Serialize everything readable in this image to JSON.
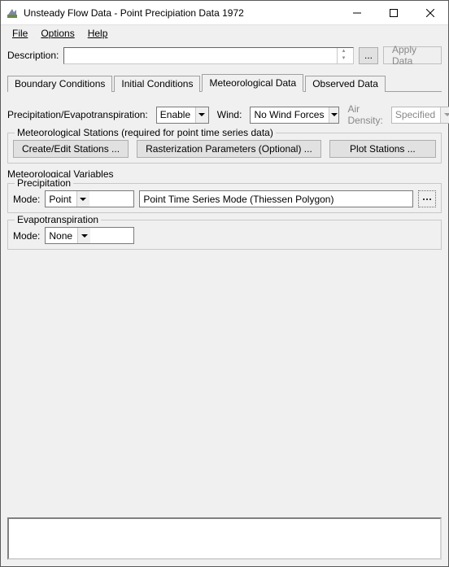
{
  "window": {
    "title": "Unsteady Flow Data - Point Precipiation Data 1972"
  },
  "menubar": {
    "file": "File",
    "options": "Options",
    "help": "Help"
  },
  "description": {
    "label": "Description:",
    "value": ""
  },
  "buttons": {
    "browse": "...",
    "apply": "Apply Data"
  },
  "tabs": {
    "boundary": "Boundary Conditions",
    "initial": "Initial Conditions",
    "meteo": "Meteorological Data",
    "observed": "Observed Data"
  },
  "controls": {
    "precip_label": "Precipitation/Evapotranspiration:",
    "precip_value": "Enable",
    "wind_label": "Wind:",
    "wind_value": "No Wind Forces",
    "airdensity_label": "Air Density:",
    "airdensity_value": "Specified"
  },
  "stations": {
    "title": "Meteorological Stations (required for point time series data)",
    "create": "Create/Edit Stations ...",
    "raster": "Rasterization Parameters (Optional) ...",
    "plot": "Plot Stations ..."
  },
  "variables": {
    "title": "Meteorological Variables",
    "precip": {
      "title": "Precipitation",
      "mode_label": "Mode:",
      "mode_value": "Point",
      "desc": "Point Time Series Mode (Thiessen Polygon)"
    },
    "evap": {
      "title": "Evapotranspiration",
      "mode_label": "Mode:",
      "mode_value": "None"
    }
  }
}
